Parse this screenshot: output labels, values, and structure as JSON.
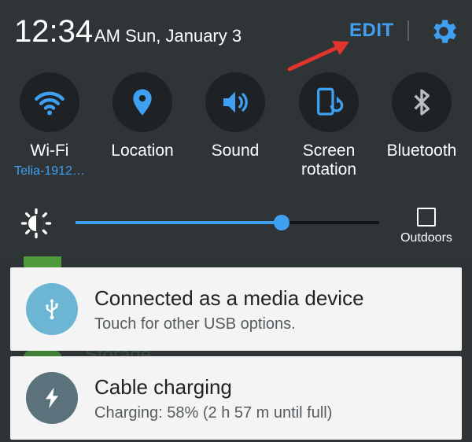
{
  "status": {
    "time": "12:34",
    "ampm_date": "AM Sun, January 3",
    "edit_label": "EDIT"
  },
  "tiles": [
    {
      "label": "Wi-Fi",
      "sublabel": "Telia-1912…",
      "icon": "wifi-icon",
      "active": true
    },
    {
      "label": "Location",
      "icon": "location-pin-icon",
      "active": true
    },
    {
      "label": "Sound",
      "icon": "speaker-icon",
      "active": true
    },
    {
      "label_line1": "Screen",
      "label_line2": "rotation",
      "icon": "screen-rotation-icon",
      "active": true
    },
    {
      "label": "Bluetooth",
      "icon": "bluetooth-icon",
      "active": false
    }
  ],
  "brightness": {
    "level": 0.68,
    "outdoors_label": "Outdoors"
  },
  "background": {
    "storage_text": "Storage"
  },
  "notifications": [
    {
      "title": "Connected as a media device",
      "subtitle": "Touch for other USB options.",
      "icon": "usb-icon",
      "icon_color": "#6cb6d4"
    },
    {
      "title": "Cable charging",
      "subtitle": "Charging: 58% (2 h 57 m until full)",
      "icon": "lightning-bolt-icon",
      "icon_color": "#5b717c"
    }
  ],
  "colors": {
    "accent": "#3fa0f2",
    "panel_bg": "#2f3437",
    "annotation_arrow": "#e0342c"
  }
}
